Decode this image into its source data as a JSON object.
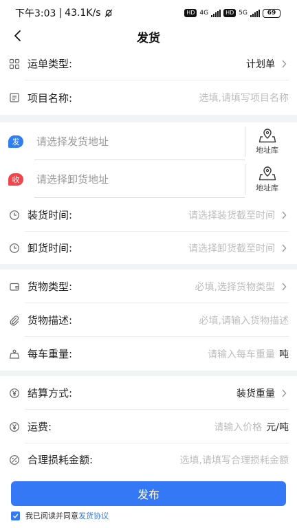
{
  "status_bar": {
    "time": "下午3:03",
    "speed": "43.1K/s",
    "net1": "4G",
    "net2": "5G",
    "hd": "HD",
    "battery": "69"
  },
  "header": {
    "title": "发货"
  },
  "waybill": {
    "type_label": "运单类型:",
    "type_value": "计划单",
    "project_label": "项目名称:",
    "project_placeholder": "选填,请填写项目名称"
  },
  "address": {
    "send_badge": "发",
    "send_placeholder": "请选择发货地址",
    "recv_badge": "收",
    "recv_placeholder": "请选择卸货地址",
    "library_label": "地址库",
    "load_time_label": "装货时间:",
    "load_time_placeholder": "请选择装货截至时间",
    "unload_time_label": "卸货时间:",
    "unload_time_placeholder": "请选择卸货截至时间"
  },
  "goods": {
    "type_label": "货物类型:",
    "type_placeholder": "必填,选择货物类型",
    "desc_label": "货物描述:",
    "desc_placeholder": "必填,请输入货物描述",
    "weight_label": "每车重量:",
    "weight_placeholder": "请输入每车重量",
    "weight_unit": "吨"
  },
  "settlement": {
    "method_label": "结算方式:",
    "method_value": "装货重量",
    "freight_label": "运费:",
    "freight_placeholder": "请输入价格",
    "freight_unit": "元/吨",
    "loss_label": "合理损耗金额:",
    "loss_placeholder": "选填,请填写合理损耗金额"
  },
  "footer": {
    "publish_label": "发布",
    "agree_text": "我已阅读并同意",
    "agree_link": "发货协议"
  },
  "colors": {
    "accent": "#3478f6",
    "send_badge": "#2f7ef5",
    "recv_badge": "#f0464b"
  }
}
